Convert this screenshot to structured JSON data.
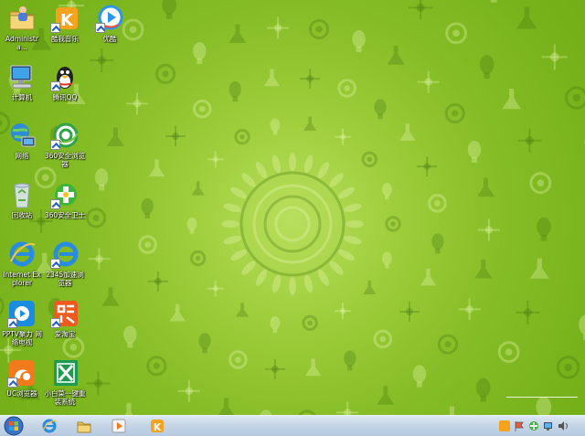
{
  "desktop_icons": [
    {
      "label": "Administra...",
      "icon": "user-folder-icon"
    },
    {
      "label": "计算机",
      "icon": "computer-icon"
    },
    {
      "label": "网络",
      "icon": "network-icon"
    },
    {
      "label": "回收站",
      "icon": "recycle-bin-icon"
    },
    {
      "label": "Internet Explorer",
      "icon": "ie-icon"
    },
    {
      "label": "PPTV聚力 网络电视",
      "icon": "pptv-icon"
    },
    {
      "label": "UC浏览器",
      "icon": "uc-browser-icon"
    },
    {
      "label": "酷我音乐",
      "icon": "kuwo-music-icon"
    },
    {
      "label": "腾讯QQ",
      "icon": "qq-penguin-icon"
    },
    {
      "label": "360安全浏览器",
      "icon": "360-browser-icon"
    },
    {
      "label": "360安全卫士",
      "icon": "360-security-icon"
    },
    {
      "label": "2345加速浏览器",
      "icon": "2345-browser-icon"
    },
    {
      "label": "爱淘宝",
      "icon": "taobao-icon"
    },
    {
      "label": "小白菜一键重装系统",
      "icon": "xiaobaicai-icon"
    },
    {
      "label": "优酷",
      "icon": "youku-icon"
    }
  ],
  "taskbar": {
    "start": "windows-start-icon",
    "pinned": [
      "ie-icon",
      "explorer-folder-icon",
      "media-player-icon",
      "kuwo-icon"
    ],
    "tray": [
      "tray-kuwo-icon",
      "tray-flag-icon",
      "tray-360-icon",
      "tray-network-icon",
      "tray-volume-icon"
    ]
  },
  "colors": {
    "wallpaper": "#86bd26",
    "wallpaper_center": "#b9df5e",
    "taskbar": "#c6d6e7"
  }
}
